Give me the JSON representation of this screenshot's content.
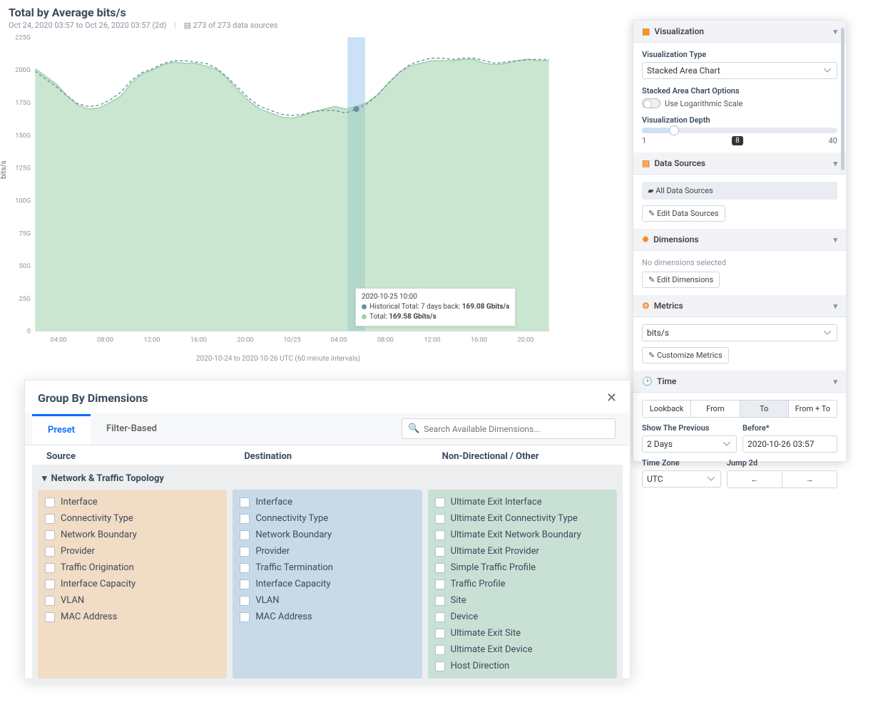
{
  "chart": {
    "title": "Total by Average bits/s",
    "subtitle_range": "Oct 24, 2020 03:57 to Oct 26, 2020 03:57 (2d)",
    "subtitle_sources": "273 of 273 data sources",
    "y_label": "bits/s",
    "x_caption": "2020-10-24 to 2020-10-26 UTC (60 minute intervals)",
    "tooltip": {
      "time": "2020-10-25 10:00",
      "historical_label": "Historical Total: 7 days back:",
      "historical_value": "169.08 Gbits/s",
      "total_label": "Total:",
      "total_value": "169.58 Gbits/s"
    }
  },
  "chart_data": {
    "type": "area",
    "ylabel": "bits/s",
    "ylim": [
      0,
      225
    ],
    "unit": "G",
    "x_ticks": [
      "04:00",
      "08:00",
      "12:00",
      "16:00",
      "20:00",
      "10/25",
      "04:00",
      "08:00",
      "12:00",
      "16:00",
      "20:00"
    ],
    "y_ticks": [
      0,
      25,
      50,
      75,
      100,
      125,
      150,
      175,
      200,
      225
    ],
    "series": [
      {
        "name": "Total",
        "color": "#9fd2a9",
        "values": [
          201,
          195,
          189,
          180,
          173,
          170,
          171,
          175,
          180,
          190,
          197,
          200,
          204,
          206,
          205,
          205,
          203,
          200,
          193,
          184,
          176,
          170,
          167,
          164,
          163,
          165,
          168,
          170,
          172,
          170,
          172,
          175,
          181,
          190,
          198,
          203,
          205,
          207,
          207,
          207,
          208,
          208,
          205,
          204,
          205,
          207,
          208,
          207,
          207
        ]
      },
      {
        "name": "Historical Total: 7 days back",
        "color": "#6b8fa5",
        "style": "dashed",
        "values": [
          199,
          193,
          187,
          180,
          174,
          172,
          173,
          177,
          183,
          192,
          198,
          201,
          205,
          207,
          207,
          206,
          205,
          201,
          194,
          186,
          178,
          172,
          169,
          166,
          165,
          166,
          168,
          169,
          169,
          167,
          170,
          174,
          181,
          190,
          198,
          204,
          207,
          209,
          209,
          208,
          209,
          209,
          207,
          205,
          206,
          207,
          208,
          208,
          208
        ]
      }
    ],
    "highlight_x_index": 30
  },
  "sidebar": {
    "viz": {
      "title": "Visualization",
      "type_label": "Visualization Type",
      "type_value": "Stacked Area Chart",
      "options_label": "Stacked Area Chart Options",
      "log_label": "Use Logarithmic Scale",
      "depth_label": "Visualization Depth",
      "depth_min": "1",
      "depth_max": "40",
      "depth_value": "8"
    },
    "ds": {
      "title": "Data Sources",
      "all": "All Data Sources",
      "edit": "Edit Data Sources"
    },
    "dim": {
      "title": "Dimensions",
      "note": "No dimensions selected",
      "edit": "Edit Dimensions"
    },
    "metrics": {
      "title": "Metrics",
      "value": "bits/s",
      "customize": "Customize Metrics"
    },
    "time": {
      "title": "Time",
      "tabs": [
        "Lookback",
        "From",
        "To",
        "From + To"
      ],
      "active_tab": 2,
      "show_prev_label": "Show The Previous",
      "show_prev_value": "2 Days",
      "before_label": "Before*",
      "before_value": "2020-10-26 03:57",
      "tz_label": "Time Zone",
      "tz_value": "UTC",
      "jump_label": "Jump 2d"
    }
  },
  "modal": {
    "title": "Group By Dimensions",
    "tabs": {
      "preset": "Preset",
      "filter": "Filter-Based"
    },
    "search_placeholder": "Search Available Dimensions...",
    "col_headers": [
      "Source",
      "Destination",
      "Non-Directional / Other"
    ],
    "group_title": "Network & Traffic Topology",
    "cols": {
      "src": [
        "Interface",
        "Connectivity Type",
        "Network Boundary",
        "Provider",
        "Traffic Origination",
        "Interface Capacity",
        "VLAN",
        "MAC Address"
      ],
      "dst": [
        "Interface",
        "Connectivity Type",
        "Network Boundary",
        "Provider",
        "Traffic Termination",
        "Interface Capacity",
        "VLAN",
        "MAC Address"
      ],
      "nd": [
        "Ultimate Exit Interface",
        "Ultimate Exit Connectivity Type",
        "Ultimate Exit Network Boundary",
        "Ultimate Exit Provider",
        "Simple Traffic Profile",
        "Traffic Profile",
        "Site",
        "Device",
        "Ultimate Exit Site",
        "Ultimate Exit Device",
        "Host Direction"
      ]
    }
  },
  "colors": {
    "historical": "#6b8fa5",
    "total": "#9fd2a9"
  }
}
